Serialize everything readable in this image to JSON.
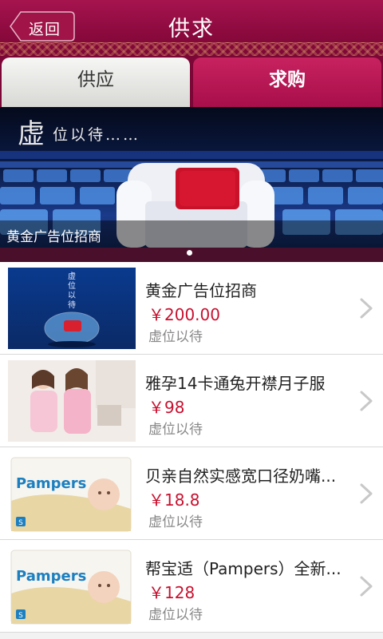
{
  "header": {
    "back_label": "返回",
    "title": "供求"
  },
  "tabs": [
    {
      "label": "供应",
      "active": false
    },
    {
      "label": "求购",
      "active": true
    }
  ],
  "banner": {
    "headline_big": "虚",
    "headline_small": "位以待……",
    "caption": "黄金广告位招商",
    "page_count": 1,
    "active_page": 0
  },
  "list": [
    {
      "title": "黄金广告位招商",
      "price": "￥200.00",
      "subtitle": "虚位以待",
      "thumb": "ad-placeholder"
    },
    {
      "title": "雅孕14卡通兔开襟月子服",
      "price": "￥98",
      "subtitle": "虚位以待",
      "thumb": "maternity-clothes"
    },
    {
      "title": "贝亲自然实感宽口径奶嘴...",
      "price": "￥18.8",
      "subtitle": "虚位以待",
      "thumb": "pampers-pack"
    },
    {
      "title": "帮宝适（Pampers）全新...",
      "price": "￥128",
      "subtitle": "虚位以待",
      "thumb": "pampers-pack"
    }
  ],
  "thumb_texts": {
    "ad_vertical": [
      "虚",
      "位",
      "以",
      "待"
    ],
    "brand": "Pampers",
    "pack_size": "S"
  },
  "colors": {
    "header": "#8d0a3f",
    "price": "#c8102e",
    "tab_active": "#b0144f"
  }
}
